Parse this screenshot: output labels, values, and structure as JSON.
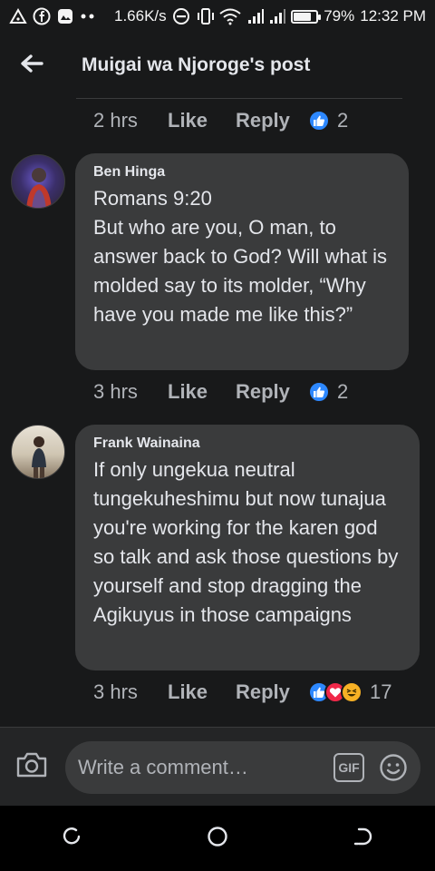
{
  "status_bar": {
    "speed": "1.66K/s",
    "battery": "79%",
    "battery_level": 0.79,
    "time": "12:32 PM",
    "icons": [
      "notification-icon",
      "facebook-icon",
      "gallery-icon",
      "more-dots-icon",
      "dnd-icon",
      "vibrate-icon",
      "wifi-icon",
      "signal-icon",
      "signal-icon-2",
      "battery-icon"
    ]
  },
  "header": {
    "title": "Muigai wa Njoroge's post",
    "back_icon": "arrow-left-icon"
  },
  "comments": [
    {
      "time": "2 hrs",
      "like_label": "Like",
      "reply_label": "Reply",
      "reactions": [
        "like"
      ],
      "reaction_count": "2"
    },
    {
      "author": "Ben Hinga",
      "text": "Romans 9:20\nBut who are you, O man, to answer back to God? Will what is molded say to its molder, “Why have you made me like this?”",
      "time": "3 hrs",
      "like_label": "Like",
      "reply_label": "Reply",
      "reactions": [
        "like"
      ],
      "reaction_count": "2"
    },
    {
      "author": "Frank Wainaina",
      "text": "If only ungekua neutral tungekuheshimu but now tunajua you're working for the karen god so talk and ask those questions by yourself and stop dragging the Agikuyus in those campaigns",
      "time": "3 hrs",
      "like_label": "Like",
      "reply_label": "Reply",
      "reactions": [
        "like",
        "love",
        "haha"
      ],
      "reaction_count": "17"
    }
  ],
  "composer": {
    "placeholder": "Write a comment…",
    "gif_label": "GIF"
  },
  "colors": {
    "background": "#18191a",
    "bubble": "#3a3b3c",
    "secondary_text": "#b0b3b8",
    "like_blue": "#2d88ff",
    "love_red": "#f02849",
    "haha_yellow": "#f7b125"
  }
}
